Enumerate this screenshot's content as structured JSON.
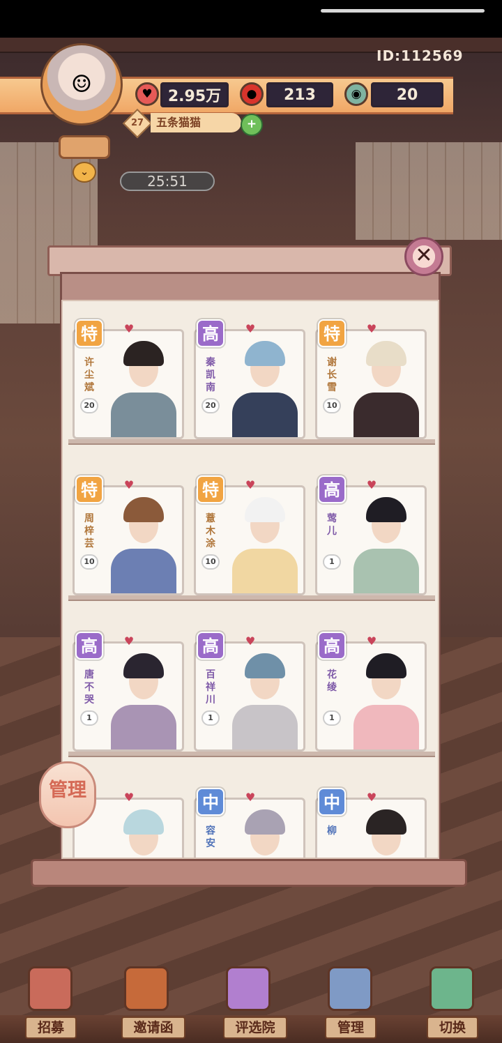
{
  "player": {
    "id": "ID:112569",
    "name": "五条猫猫",
    "level": "27"
  },
  "resources": [
    {
      "icon": "heart-gem-icon",
      "value": "2.95万"
    },
    {
      "icon": "red-fruit-icon",
      "value": "213"
    },
    {
      "icon": "green-orb-icon",
      "value": "20"
    }
  ],
  "timer": "25:51",
  "panel": {
    "close_label": "✕",
    "manage_label": "管理"
  },
  "characters": [
    {
      "name": "许尘斌",
      "rank": "特",
      "level": "20",
      "rank_type": "te",
      "hair": "#2b2322",
      "cloth": "#7a8e9a"
    },
    {
      "name": "秦凯南",
      "rank": "高",
      "level": "20",
      "rank_type": "gao",
      "hair": "#8fb4cf",
      "cloth": "#35405a"
    },
    {
      "name": "谢长雪",
      "rank": "特",
      "level": "10",
      "rank_type": "te",
      "hair": "#e8ddc8",
      "cloth": "#3a2b2d"
    },
    {
      "name": "周梓芸",
      "rank": "特",
      "level": "10",
      "rank_type": "te",
      "hair": "#8b5a3a",
      "cloth": "#6c7fb3"
    },
    {
      "name": "薏木涂",
      "rank": "特",
      "level": "10",
      "rank_type": "te",
      "hair": "#f2f2f2",
      "cloth": "#f1d7a2"
    },
    {
      "name": "莺儿",
      "rank": "高",
      "level": "1",
      "rank_type": "gao",
      "hair": "#1f1d24",
      "cloth": "#a9c2b0"
    },
    {
      "name": "唐不哭",
      "rank": "高",
      "level": "1",
      "rank_type": "gao",
      "hair": "#2a2530",
      "cloth": "#a994b4"
    },
    {
      "name": "百祥川",
      "rank": "高",
      "level": "1",
      "rank_type": "gao",
      "hair": "#6f90a8",
      "cloth": "#c8c4c8"
    },
    {
      "name": "花绫",
      "rank": "高",
      "level": "1",
      "rank_type": "gao",
      "hair": "#1f1d24",
      "cloth": "#f0b8bd"
    },
    {
      "name": "",
      "rank": "",
      "level": "",
      "rank_type": "gao",
      "hair": "#b9d7de",
      "cloth": "#cfd9de"
    },
    {
      "name": "容安",
      "rank": "中",
      "level": "",
      "rank_type": "zhong",
      "hair": "#a9a2b3",
      "cloth": "#c6bccb"
    },
    {
      "name": "柳",
      "rank": "中",
      "level": "",
      "rank_type": "zhong",
      "hair": "#2a2424",
      "cloth": "#b6423e"
    }
  ],
  "nav": [
    {
      "label": "招募",
      "icon": "recruit-icon",
      "color": "#c96b5b"
    },
    {
      "label": "邀请函",
      "icon": "invitation-icon",
      "color": "#c66a3a"
    },
    {
      "label": "评选院",
      "icon": "selection-hall-icon",
      "color": "#b17fcf"
    },
    {
      "label": "管理",
      "icon": "management-icon",
      "color": "#7f9ac5"
    },
    {
      "label": "切换",
      "icon": "switch-icon",
      "color": "#6db58c"
    }
  ]
}
